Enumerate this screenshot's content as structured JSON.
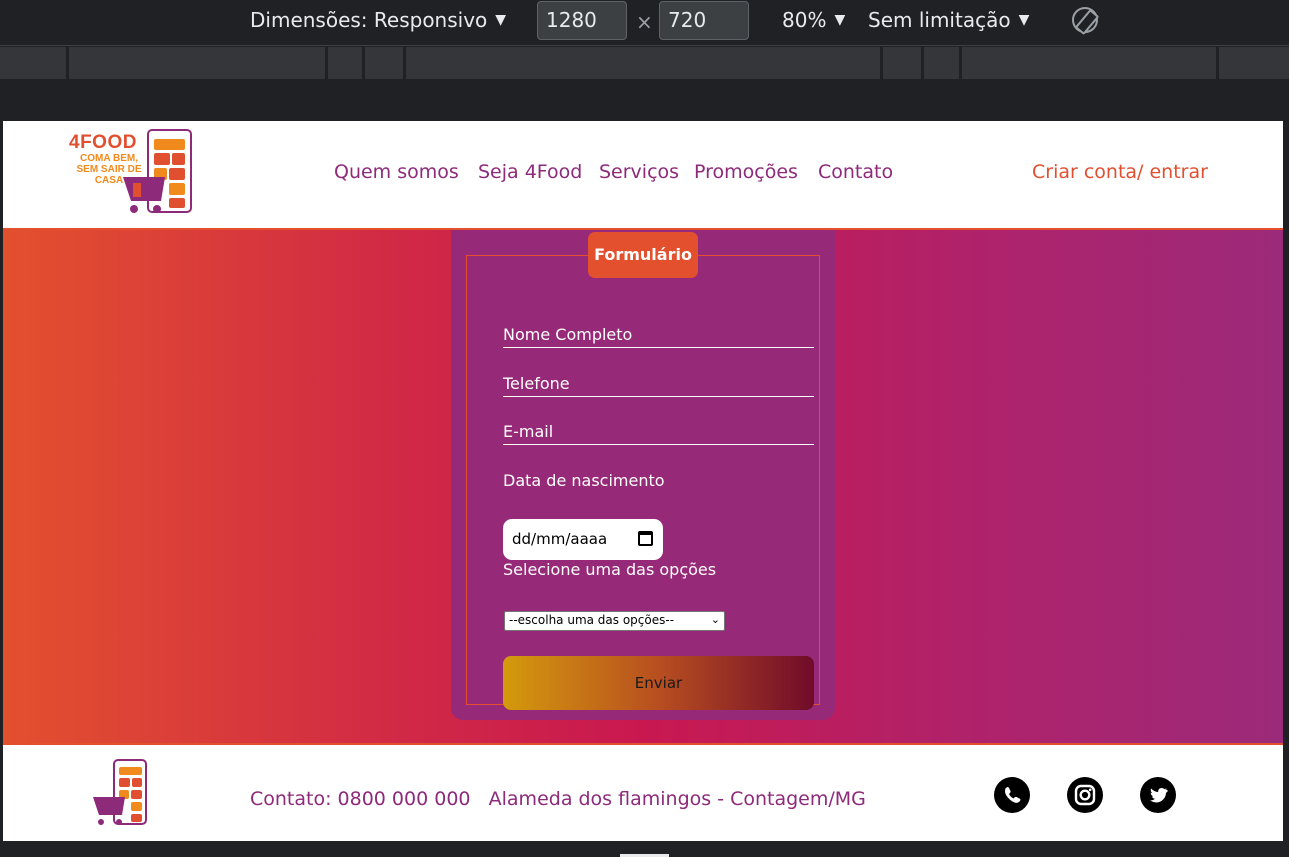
{
  "devtools": {
    "dimensions_label": "Dimensões: Responsivo",
    "width": "1280",
    "height": "720",
    "zoom": "80%",
    "throttle": "Sem limitação",
    "caret": "▼",
    "times": "×"
  },
  "header": {
    "logo": {
      "brand": "4FOOD",
      "tagline_line1": "COMA BEM,",
      "tagline_line2": "SEM SAIR DE",
      "tagline_line3": "CASA"
    },
    "nav": [
      "Quem somos",
      "Seja 4Food",
      "Serviços",
      "Promoções",
      "Contato"
    ],
    "login": "Criar conta/ entrar"
  },
  "form": {
    "legend": "Formulário",
    "name_label": "Nome Completo",
    "phone_label": "Telefone",
    "email_label": "E-mail",
    "birth_label": "Data de nascimento",
    "birth_placeholder": "dd/mm/aaaa",
    "select_label": "Selecione uma das opções",
    "select_value": "--escolha uma das opções--",
    "submit": "Enviar"
  },
  "footer": {
    "contact": "Contato: 0800 000 000",
    "address": "Alameda dos flamingos - Contagem/MG",
    "social": [
      "whatsapp-icon",
      "instagram-icon",
      "twitter-icon"
    ]
  },
  "colors": {
    "brand_purple": "#8e2a7a",
    "brand_orange": "#e05030",
    "card_purple": "#972a78"
  }
}
